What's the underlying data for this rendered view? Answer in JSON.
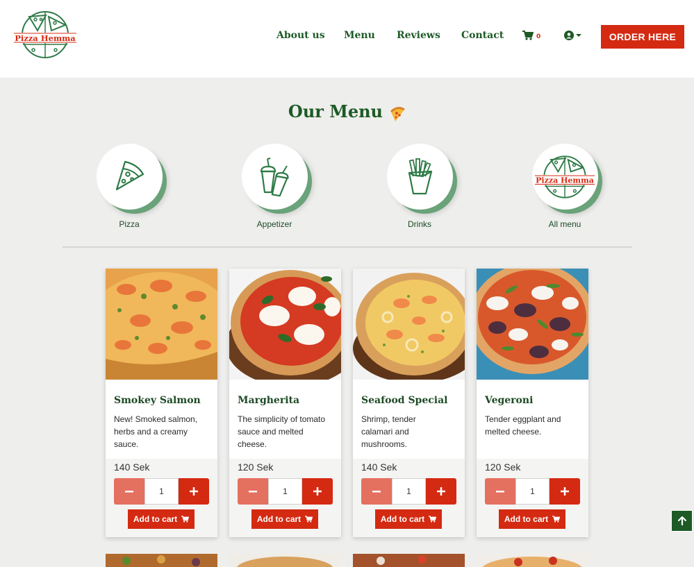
{
  "header": {
    "logo_text": "Pizza Hemma",
    "nav": [
      "About us",
      "Menu",
      "Reviews",
      "Contact"
    ],
    "cart_count": "0",
    "order_button": "ORDER HERE"
  },
  "menu_title": "Our Menu",
  "categories": [
    {
      "label": "Pizza",
      "icon": "pizza-slice-icon"
    },
    {
      "label": "Appetizer",
      "icon": "drinks-cups-icon"
    },
    {
      "label": "Drinks",
      "icon": "fries-icon"
    },
    {
      "label": "All menu",
      "icon": "pizza-hemma-logo"
    }
  ],
  "products": [
    {
      "name": "Smokey Salmon",
      "description": "New! Smoked salmon, herbs and a creamy sauce.",
      "price": "140 Sek",
      "quantity": "1",
      "add_label": "Add to cart"
    },
    {
      "name": "Margherita",
      "description": "The simplicity of tomato sauce and melted cheese.",
      "price": "120 Sek",
      "quantity": "1",
      "add_label": "Add to cart"
    },
    {
      "name": "Seafood Special",
      "description": "Shrimp, tender calamari and mushrooms.",
      "price": "140 Sek",
      "quantity": "1",
      "add_label": "Add to cart"
    },
    {
      "name": "Vegeroni",
      "description": "Tender eggplant and melted cheese.",
      "price": "120 Sek",
      "quantity": "1",
      "add_label": "Add to cart"
    }
  ],
  "colors": {
    "brand_green": "#1d5a26",
    "brand_red": "#d42a12",
    "minus_red": "#e4705f",
    "background": "#eeeeec"
  }
}
